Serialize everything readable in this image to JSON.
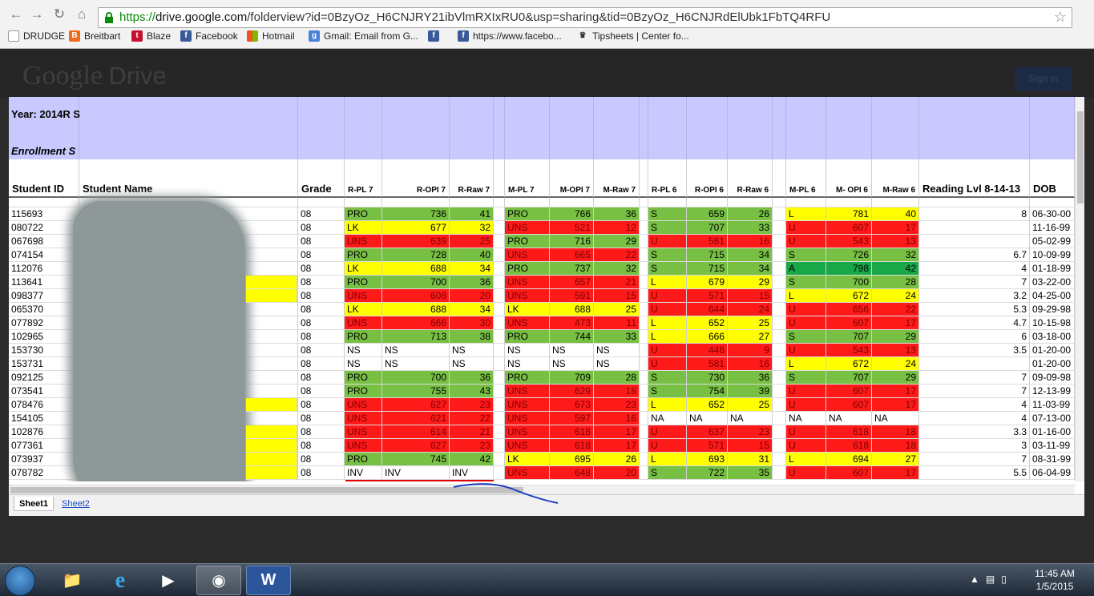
{
  "browser": {
    "url_scheme": "https://",
    "url_host": "drive.google.com",
    "url_path": "/folderview?id=0BzyOz_H6CNJRY21ibVlmRXIxRU0&usp=sharing&tid=0BzyOz_H6CNJRdElUbk1FbTQ4RFU",
    "bookmarks": [
      "DRUDGE",
      "Breitbart",
      "Blaze",
      "Facebook",
      "Hotmail",
      "Gmail: Email from G...",
      "",
      "https://www.facebo...",
      "Tipsheets | Center fo..."
    ]
  },
  "drive": {
    "logo_google": "Google",
    "logo_drive": "Drive",
    "signin_label": "Sign in"
  },
  "sheet": {
    "year_label": "Year: 2014R S",
    "enrollment_label": "Enrollment S",
    "headers": [
      "Student ID",
      "Student Name",
      "Grade",
      "R-PL 7",
      "R-OPI 7",
      "R-Raw 7",
      "M-PL 7",
      "M-OPI 7",
      "M-Raw 7",
      "R-PL 6",
      "R-OPI 6",
      "R-Raw 6",
      "M-PL 6",
      "M- OPI 6",
      "M-Raw 6",
      "Reading Lvl 8-14-13",
      "DOB"
    ],
    "rows": [
      {
        "id": "115693",
        "grade": "08",
        "rpl7": "PRO",
        "ropi7": "736",
        "rraw7": "41",
        "mpl7": "PRO",
        "mopi7": "766",
        "mraw7": "36",
        "rpl6": "S",
        "ropi6": "659",
        "rraw6": "26",
        "mpl6": "L",
        "mopi6": "781",
        "mraw6": "40",
        "rl": "8",
        "dob": "06-30-00"
      },
      {
        "id": "080722",
        "grade": "08",
        "rpl7": "LK",
        "ropi7": "677",
        "rraw7": "32",
        "mpl7": "UNS",
        "mopi7": "521",
        "mraw7": "12",
        "rpl6": "S",
        "ropi6": "707",
        "rraw6": "33",
        "mpl6": "U",
        "mopi6": "607",
        "mraw6": "17",
        "rl": "",
        "dob": "11-16-99"
      },
      {
        "id": "067698",
        "grade": "08",
        "rpl7": "UNS",
        "ropi7": "639",
        "rraw7": "25",
        "mpl7": "PRO",
        "mopi7": "716",
        "mraw7": "29",
        "rpl6": "U",
        "ropi6": "581",
        "rraw6": "16",
        "mpl6": "U",
        "mopi6": "543",
        "mraw6": "13",
        "rl": "",
        "dob": "05-02-99"
      },
      {
        "id": "074154",
        "grade": "08",
        "rpl7": "PRO",
        "ropi7": "728",
        "rraw7": "40",
        "mpl7": "UNS",
        "mopi7": "665",
        "mraw7": "22",
        "rpl6": "S",
        "ropi6": "715",
        "rraw6": "34",
        "mpl6": "S",
        "mopi6": "726",
        "mraw6": "32",
        "rl": "6.7",
        "dob": "10-09-99"
      },
      {
        "id": "112076",
        "grade": "08",
        "rpl7": "LK",
        "ropi7": "688",
        "rraw7": "34",
        "mpl7": "PRO",
        "mopi7": "737",
        "mraw7": "32",
        "rpl6": "S",
        "ropi6": "715",
        "rraw6": "34",
        "mpl6": "A",
        "mopi6": "798",
        "mraw6": "42",
        "rl": "4",
        "dob": "01-18-99"
      },
      {
        "id": "113641",
        "grade": "08",
        "rpl7": "PRO",
        "ropi7": "700",
        "rraw7": "36",
        "mpl7": "UNS",
        "mopi7": "657",
        "mraw7": "21",
        "rpl6": "L",
        "ropi6": "679",
        "rraw6": "29",
        "mpl6": "S",
        "mopi6": "700",
        "mraw6": "28",
        "rl": "7",
        "dob": "03-22-00"
      },
      {
        "id": "098377",
        "grade": "08",
        "rpl7": "UNS",
        "ropi7": "608",
        "rraw7": "20",
        "mpl7": "UNS",
        "mopi7": "591",
        "mraw7": "15",
        "rpl6": "U",
        "ropi6": "571",
        "rraw6": "15",
        "mpl6": "L",
        "mopi6": "672",
        "mraw6": "24",
        "rl": "3.2",
        "dob": "04-25-00"
      },
      {
        "id": "065370",
        "grade": "08",
        "rpl7": "LK",
        "ropi7": "688",
        "rraw7": "34",
        "mpl7": "LK",
        "mopi7": "688",
        "mraw7": "25",
        "rpl6": "U",
        "ropi6": "644",
        "rraw6": "24",
        "mpl6": "U",
        "mopi6": "656",
        "mraw6": "22",
        "rl": "5.3",
        "dob": "09-29-98"
      },
      {
        "id": "077892",
        "grade": "08",
        "rpl7": "UNS",
        "ropi7": "666",
        "rraw7": "30",
        "mpl7": "UNS",
        "mopi7": "473",
        "mraw7": "11",
        "rpl6": "L",
        "ropi6": "652",
        "rraw6": "25",
        "mpl6": "U",
        "mopi6": "607",
        "mraw6": "17",
        "rl": "4.7",
        "dob": "10-15-98"
      },
      {
        "id": "102965",
        "grade": "08",
        "rpl7": "PRO",
        "ropi7": "713",
        "rraw7": "38",
        "mpl7": "PRO",
        "mopi7": "744",
        "mraw7": "33",
        "rpl6": "L",
        "ropi6": "666",
        "rraw6": "27",
        "mpl6": "S",
        "mopi6": "707",
        "mraw6": "29",
        "rl": "6",
        "dob": "03-18-00"
      },
      {
        "id": "153730",
        "grade": "08",
        "rpl7": "NS",
        "ropi7": "NS",
        "rraw7": "NS",
        "mpl7": "NS",
        "mopi7": "NS",
        "mraw7": "NS",
        "rpl6": "U",
        "ropi6": "446",
        "rraw6": "9",
        "mpl6": "U",
        "mopi6": "543",
        "mraw6": "13",
        "rl": "3.5",
        "dob": "01-20-00"
      },
      {
        "id": "153731",
        "grade": "08",
        "rpl7": "NS",
        "ropi7": "NS",
        "rraw7": "NS",
        "mpl7": "NS",
        "mopi7": "NS",
        "mraw7": "NS",
        "rpl6": "U",
        "ropi6": "581",
        "rraw6": "16",
        "mpl6": "L",
        "mopi6": "672",
        "mraw6": "24",
        "rl": "",
        "dob": "01-20-00"
      },
      {
        "id": "092125",
        "grade": "08",
        "rpl7": "PRO",
        "ropi7": "700",
        "rraw7": "36",
        "mpl7": "PRO",
        "mopi7": "709",
        "mraw7": "28",
        "rpl6": "S",
        "ropi6": "730",
        "rraw6": "36",
        "mpl6": "S",
        "mopi6": "707",
        "mraw6": "29",
        "rl": "7",
        "dob": "09-09-98"
      },
      {
        "id": "073541",
        "grade": "08",
        "rpl7": "PRO",
        "ropi7": "755",
        "rraw7": "43",
        "mpl7": "UNS",
        "mopi7": "629",
        "mraw7": "18",
        "rpl6": "S",
        "ropi6": "754",
        "rraw6": "39",
        "mpl6": "U",
        "mopi6": "607",
        "mraw6": "17",
        "rl": "7",
        "dob": "12-13-99"
      },
      {
        "id": "078476",
        "grade": "08",
        "rpl7": "UNS",
        "ropi7": "627",
        "rraw7": "23",
        "mpl7": "UNS",
        "mopi7": "673",
        "mraw7": "23",
        "rpl6": "L",
        "ropi6": "652",
        "rraw6": "25",
        "mpl6": "U",
        "mopi6": "607",
        "mraw6": "17",
        "rl": "4",
        "dob": "11-03-99"
      },
      {
        "id": "154105",
        "grade": "08",
        "rpl7": "UNS",
        "ropi7": "621",
        "rraw7": "22",
        "mpl7": "UNS",
        "mopi7": "597",
        "mraw7": "16",
        "rpl6": "NA",
        "ropi6": "NA",
        "rraw6": "NA",
        "mpl6": "NA",
        "mopi6": "NA",
        "mraw6": "NA",
        "rl": "4",
        "dob": "07-13-00"
      },
      {
        "id": "102876",
        "grade": "08",
        "rpl7": "UNS",
        "ropi7": "614",
        "rraw7": "21",
        "mpl7": "UNS",
        "mopi7": "618",
        "mraw7": "17",
        "rpl6": "U",
        "ropi6": "637",
        "rraw6": "23",
        "mpl6": "U",
        "mopi6": "618",
        "mraw6": "18",
        "rl": "3.3",
        "dob": "01-16-00"
      },
      {
        "id": "077361",
        "grade": "08",
        "rpl7": "UNS",
        "ropi7": "627",
        "rraw7": "23",
        "mpl7": "UNS",
        "mopi7": "618",
        "mraw7": "17",
        "rpl6": "U",
        "ropi6": "571",
        "rraw6": "15",
        "mpl6": "U",
        "mopi6": "618",
        "mraw6": "18",
        "rl": "3",
        "dob": "03-11-99"
      },
      {
        "id": "073937",
        "grade": "08",
        "rpl7": "PRO",
        "ropi7": "745",
        "rraw7": "42",
        "mpl7": "LK",
        "mopi7": "695",
        "mraw7": "26",
        "rpl6": "L",
        "ropi6": "693",
        "rraw6": "31",
        "mpl6": "L",
        "mopi6": "694",
        "mraw6": "27",
        "rl": "7",
        "dob": "08-31-99"
      },
      {
        "id": "078782",
        "grade": "08",
        "rpl7": "INV",
        "ropi7": "INV",
        "rraw7": "INV",
        "mpl7": "UNS",
        "mopi7": "648",
        "mraw7": "20",
        "rpl6": "S",
        "ropi6": "722",
        "rraw6": "35",
        "mpl6": "U",
        "mopi6": "607",
        "mraw6": "17",
        "rl": "5.5",
        "dob": "06-04-99"
      }
    ],
    "tabs": [
      "Sheet1",
      "Sheet2"
    ],
    "colors": {
      "green": "#78c043",
      "yellow": "#ffff00",
      "red": "#ff1a1a",
      "darkgreen": "#18a84a",
      "header_fill": "#c9c9ff"
    }
  },
  "taskbar": {
    "time": "11:45 AM",
    "date": "1/5/2015"
  }
}
